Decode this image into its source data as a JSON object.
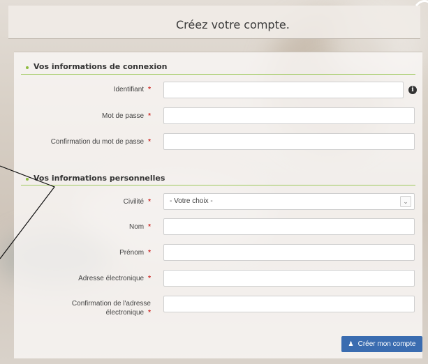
{
  "header": {
    "title": "Créez votre compte."
  },
  "sections": {
    "login": {
      "title": "Vos informations de connexion"
    },
    "personal": {
      "title": "Vos informations personnelles"
    }
  },
  "fields": {
    "identifiant": {
      "label": "Identifiant",
      "value": ""
    },
    "password": {
      "label": "Mot de passe",
      "value": ""
    },
    "password_confirm": {
      "label": "Confirmation du mot de passe",
      "value": ""
    },
    "civilite": {
      "label": "Civilité",
      "selected": "- Votre choix -"
    },
    "nom": {
      "label": "Nom",
      "value": ""
    },
    "prenom": {
      "label": "Prénom",
      "value": ""
    },
    "email": {
      "label": "Adresse électronique",
      "value": ""
    },
    "email_confirm": {
      "label_line1": "Confirmation de l'adresse",
      "label_line2": "électronique",
      "value": ""
    }
  },
  "required_marker": "*",
  "info_icon_glyph": "i",
  "submit": {
    "label": "Créer mon compte",
    "icon": "user-icon"
  },
  "colors": {
    "accent": "#8dbb3e",
    "required": "#d0312d",
    "button": "#3a6cb0"
  }
}
